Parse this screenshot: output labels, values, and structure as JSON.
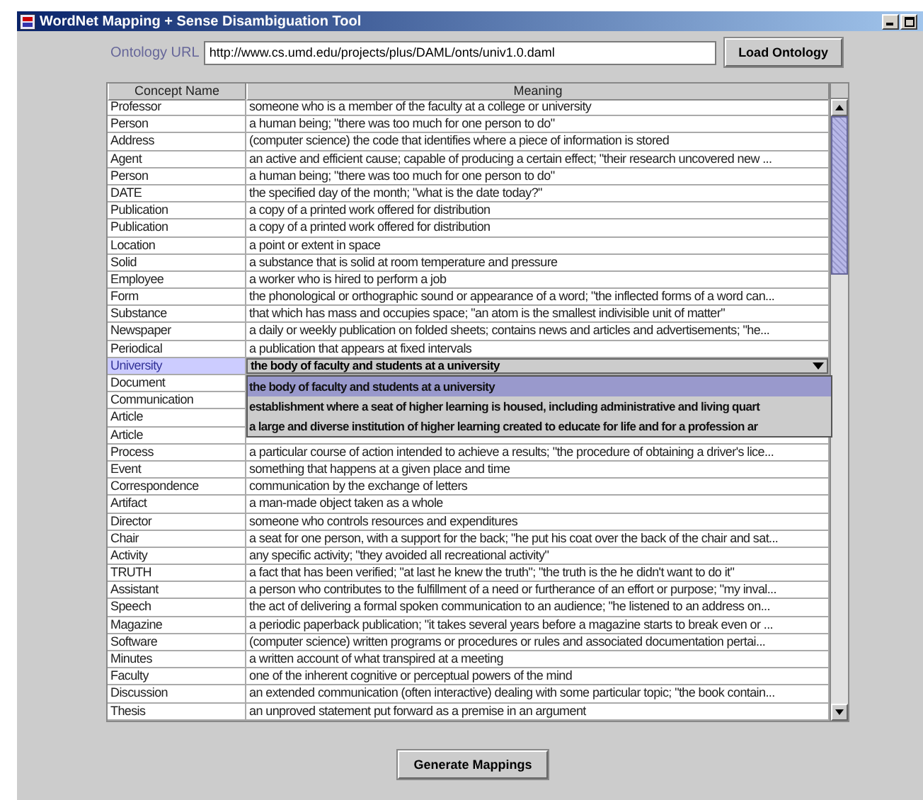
{
  "window": {
    "title": "WordNet Mapping + Sense Disambiguation Tool"
  },
  "ontology_url": {
    "label": "Ontology URL",
    "value": "http://www.cs.umd.edu/projects/plus/DAML/onts/univ1.0.daml"
  },
  "load_button": "Load Ontology",
  "table": {
    "columns": [
      "Concept Name",
      "Meaning"
    ],
    "rows": [
      {
        "concept": "Professor",
        "meaning": "someone who is a member of the faculty at a college or university",
        "selected": false
      },
      {
        "concept": "Person",
        "meaning": "a human being; \"there was too much for one person to do\"",
        "selected": false
      },
      {
        "concept": "Address",
        "meaning": "(computer science) the code that identifies where a piece of information is stored",
        "selected": false
      },
      {
        "concept": "Agent",
        "meaning": "an active and efficient cause; capable of producing a certain effect; \"their research uncovered new ...",
        "selected": false
      },
      {
        "concept": "Person",
        "meaning": "a human being; \"there was too much for one person to do\"",
        "selected": false
      },
      {
        "concept": "DATE",
        "meaning": "the specified day of the month; \"what is the date today?\"",
        "selected": false
      },
      {
        "concept": "Publication",
        "meaning": "a copy of a printed work offered for distribution",
        "selected": false
      },
      {
        "concept": "Publication",
        "meaning": "a copy of a printed work offered for distribution",
        "selected": false
      },
      {
        "concept": "Location",
        "meaning": "a point or extent in space",
        "selected": false
      },
      {
        "concept": "Solid",
        "meaning": "a substance that is solid at room temperature and pressure",
        "selected": false
      },
      {
        "concept": "Employee",
        "meaning": "a worker who is hired to perform a job",
        "selected": false
      },
      {
        "concept": "Form",
        "meaning": "the phonological or orthographic sound or appearance of a word; \"the inflected forms of a word can...",
        "selected": false
      },
      {
        "concept": "Substance",
        "meaning": "that which has mass and occupies space; \"an atom is the smallest indivisible unit of matter\"",
        "selected": false
      },
      {
        "concept": "Newspaper",
        "meaning": "a daily or weekly publication on folded sheets; contains news and articles and advertisements; \"he...",
        "selected": false
      },
      {
        "concept": "Periodical",
        "meaning": "a publication that appears at fixed intervals",
        "selected": false
      },
      {
        "concept": "University",
        "selected": true,
        "editor": {
          "value": "the body of faculty and students at a university",
          "options": [
            {
              "text": "the body of faculty and students at a university",
              "selected": true
            },
            {
              "text": "establishment where a seat of higher learning is housed, including administrative and living quart",
              "selected": false
            },
            {
              "text": "a large and diverse institution of higher learning created to educate for life and for a profession ar",
              "selected": false
            }
          ]
        }
      },
      {
        "concept": "Document",
        "selected": false
      },
      {
        "concept": "Communication",
        "selected": false
      },
      {
        "concept": "Article",
        "selected": false
      },
      {
        "concept": "Article",
        "selected": false
      },
      {
        "concept": "Process",
        "meaning": "a particular course of action intended to achieve a results; \"the procedure of obtaining a driver's lice...",
        "selected": false
      },
      {
        "concept": "Event",
        "meaning": "something that happens at a given place and time",
        "selected": false
      },
      {
        "concept": "Correspondence",
        "meaning": "communication by the exchange of letters",
        "selected": false
      },
      {
        "concept": "Artifact",
        "meaning": "a man-made object taken as a whole",
        "selected": false
      },
      {
        "concept": "Director",
        "meaning": "someone who controls resources and expenditures",
        "selected": false
      },
      {
        "concept": "Chair",
        "meaning": "a seat for one person, with a support for the back; \"he put his coat over the back of the chair and sat...",
        "selected": false
      },
      {
        "concept": "Activity",
        "meaning": "any specific activity; \"they avoided all recreational activity\"",
        "selected": false
      },
      {
        "concept": "TRUTH",
        "meaning": "a fact that has been verified; \"at last he knew the truth\"; \"the truth is the he didn't want to do it\"",
        "selected": false
      },
      {
        "concept": "Assistant",
        "meaning": "a person who contributes to the fulfillment of a need or furtherance of an effort or purpose; \"my inval...",
        "selected": false
      },
      {
        "concept": "Speech",
        "meaning": "the act of delivering a formal spoken communication to an audience; \"he listened to an address on...",
        "selected": false
      },
      {
        "concept": "Magazine",
        "meaning": "a periodic paperback publication; \"it takes several years before a magazine starts to break even or ...",
        "selected": false
      },
      {
        "concept": "Software",
        "meaning": "(computer science) written programs or procedures or rules and associated documentation pertai...",
        "selected": false
      },
      {
        "concept": "Minutes",
        "meaning": "a written account of what transpired at a meeting",
        "selected": false
      },
      {
        "concept": "Faculty",
        "meaning": "one of the inherent cognitive or perceptual powers of the mind",
        "selected": false
      },
      {
        "concept": "Discussion",
        "meaning": "an extended communication (often interactive) dealing with some particular topic; \"the book contain...",
        "selected": false
      },
      {
        "concept": "Thesis",
        "meaning": "an unproved statement put forward as a premise in an argument",
        "selected": false
      }
    ]
  },
  "generate_button": "Generate Mappings"
}
